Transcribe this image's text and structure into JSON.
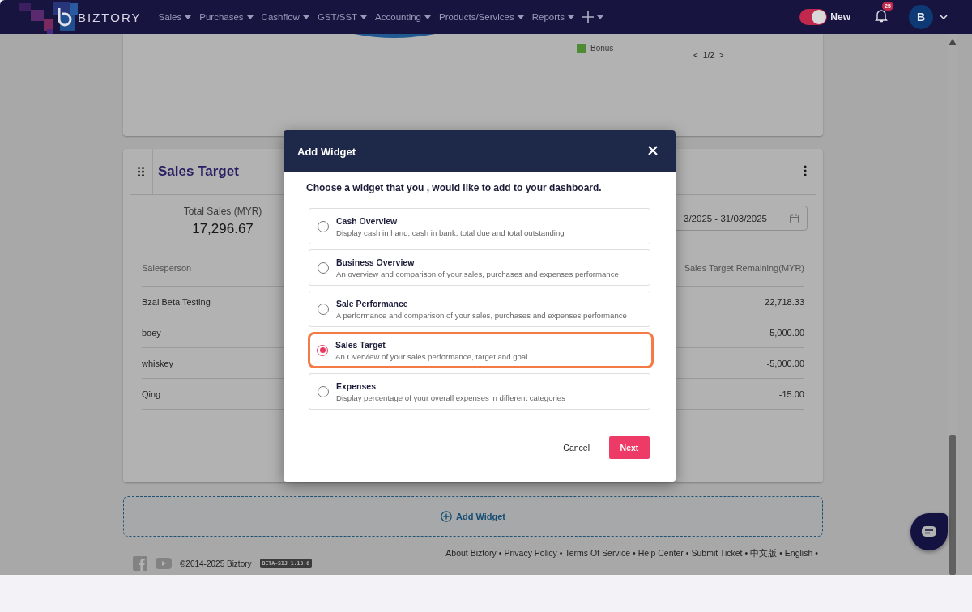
{
  "nav": {
    "brand": "BIZTORY",
    "menus": [
      "Sales",
      "Purchases",
      "Cashflow",
      "GST/SST",
      "Accounting",
      "Products/Services",
      "Reports"
    ],
    "new_toggle": {
      "label": "New",
      "on": true
    },
    "notifications": {
      "count": "25"
    },
    "avatar": {
      "initial": "B"
    }
  },
  "summary_card": {
    "legend": [
      {
        "label": "Bonus",
        "color": "#4f8a35"
      }
    ],
    "pager": {
      "prev": "<",
      "page": "1/2",
      "next": ">"
    }
  },
  "sales_target": {
    "title": "Sales Target",
    "total_label": "Total Sales (MYR)",
    "total_value": "17,296.67",
    "date_range": "3/2025 - 31/03/2025",
    "columns": [
      "Salesperson",
      "Sales Target Remaining(MYR)"
    ],
    "rows": [
      {
        "name": "Bzai Beta Testing",
        "remaining": "22,718.33"
      },
      {
        "name": "boey",
        "remaining": "-5,000.00"
      },
      {
        "name": "whiskey",
        "remaining": "-5,000.00"
      },
      {
        "name": "Qing",
        "remaining": "-15.00"
      }
    ]
  },
  "add_widget": {
    "label": "Add Widget"
  },
  "footer": {
    "copyright": "©2014-2025 Biztory",
    "version": "BETA-SIJ 1.13.0",
    "separator": "•",
    "links": [
      "About Biztory",
      "Privacy Policy",
      "Terms Of Service",
      "Help Center",
      "Submit Ticket",
      "中文版",
      "English"
    ]
  },
  "dialog": {
    "title": "Add Widget",
    "prompt": "Choose a widget that you , would like to add to your dashboard.",
    "options": [
      {
        "title": "Cash Overview",
        "description": "Display cash in hand, cash in bank, total due and total outstanding",
        "selected": false
      },
      {
        "title": "Business Overview",
        "description": "An overview and comparison of your sales, purchases and expenses performance",
        "selected": false
      },
      {
        "title": "Sale Performance",
        "description": "A performance and comparison of your sales, purchases and expenses performance",
        "selected": false
      },
      {
        "title": "Sales Target",
        "description": "An Overview of your sales performance, target and goal",
        "selected": true
      },
      {
        "title": "Expenses",
        "description": "Display percentage of your overall expenses in different categories",
        "selected": false
      }
    ],
    "cancel": "Cancel",
    "next": "Next"
  }
}
